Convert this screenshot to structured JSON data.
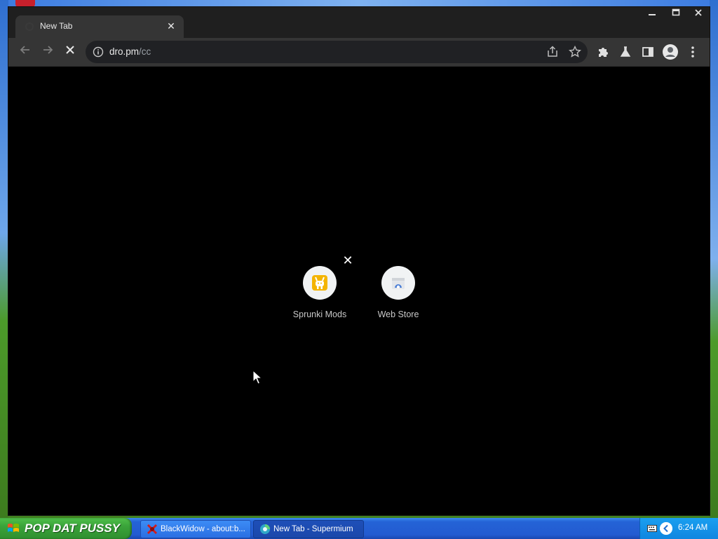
{
  "browser": {
    "tab": {
      "title": "New Tab",
      "close_label": "✕"
    },
    "window_controls": {
      "minimize": "—",
      "maximize": "☐",
      "close": "✕"
    },
    "toolbar": {
      "back_label": "←",
      "forward_label": "→",
      "stop_label": "✕",
      "url_host": "dro.pm",
      "url_path": "/cc"
    },
    "shortcuts": [
      {
        "label": "Sprunki Mods",
        "icon": "sprunki-icon"
      },
      {
        "label": "Web Store",
        "icon": "web-store-icon"
      }
    ],
    "remove_shortcut_label": "✕"
  },
  "taskbar": {
    "start_label": "POP DAT PUSSY",
    "tasks": [
      {
        "label": "BlackWidow - about:b...",
        "icon": "blackwidow-icon",
        "active": false
      },
      {
        "label": "New Tab - Supermium",
        "icon": "supermium-icon",
        "active": true
      }
    ],
    "clock": "6:24 AM"
  },
  "colors": {
    "titlebar": "#1f1f1f",
    "toolbar": "#353535",
    "content_bg": "#000000",
    "taskbar_blue": "#235bd1",
    "start_green": "#3aa33a"
  }
}
